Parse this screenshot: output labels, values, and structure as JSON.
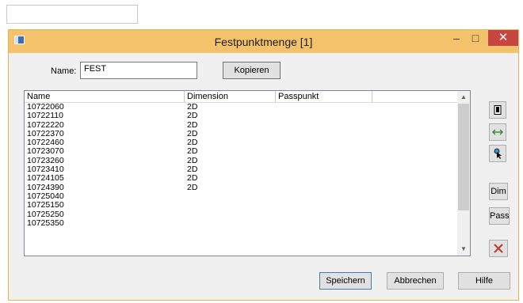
{
  "window": {
    "title": "Festpunktmenge [1]",
    "minimize": "‒",
    "maximize": "□",
    "close": "✕"
  },
  "form": {
    "name_label": "Name:",
    "name_value": "FEST",
    "copy_button": "Kopieren"
  },
  "list": {
    "headers": [
      "Name",
      "Dimension",
      "Passpunkt",
      ""
    ],
    "rows": [
      {
        "name": "10722060",
        "dimension": "2D"
      },
      {
        "name": "10722110",
        "dimension": "2D"
      },
      {
        "name": "10722220",
        "dimension": "2D"
      },
      {
        "name": "10722370",
        "dimension": "2D"
      },
      {
        "name": "10722460",
        "dimension": "2D"
      },
      {
        "name": "10723070",
        "dimension": "2D"
      },
      {
        "name": "10723260",
        "dimension": "2D"
      },
      {
        "name": "10723410",
        "dimension": "2D"
      },
      {
        "name": "10724105",
        "dimension": "2D"
      },
      {
        "name": "10724390",
        "dimension": "2D"
      },
      {
        "name": "10725040",
        "dimension": ""
      },
      {
        "name": "10725150",
        "dimension": ""
      },
      {
        "name": "10725250",
        "dimension": ""
      },
      {
        "name": "10725350",
        "dimension": ""
      }
    ],
    "scroll_up": "▲",
    "scroll_down": "▼"
  },
  "side_buttons": {
    "b1_icon": "document-icon",
    "b2_icon": "arrows-horizontal-icon",
    "b3_icon": "pointer-icon",
    "dim": "Dim",
    "pass": "Pass",
    "delete_icon": "x-icon"
  },
  "footer": {
    "save": "Speichern",
    "cancel": "Abbrechen",
    "help": "Hilfe"
  },
  "colors": {
    "titlebar": "#f4c26a",
    "close": "#c7463f",
    "delete_x": "#c0392b",
    "arrows": "#2e8b2e"
  }
}
